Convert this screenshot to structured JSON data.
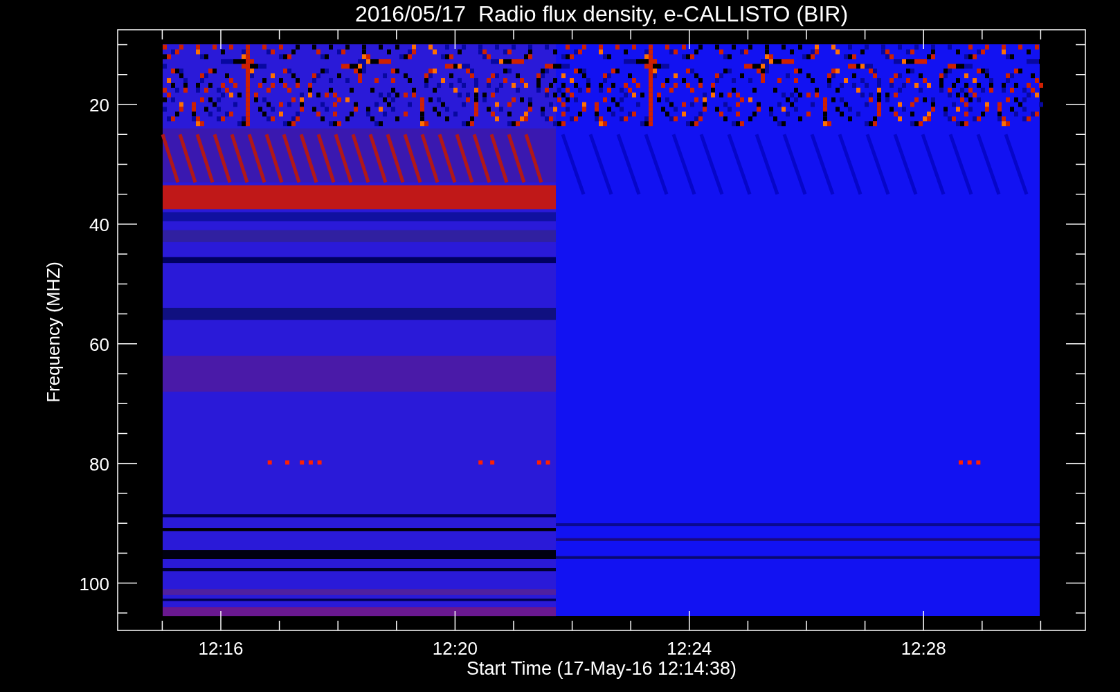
{
  "title": "2016/05/17  Radio flux density, e-CALLISTO (BIR)",
  "xlabel": "Start Time (17-May-16 12:14:38)",
  "ylabel": "Frequency (MHZ)",
  "y_ticks": [
    "20",
    "40",
    "60",
    "80",
    "100"
  ],
  "x_ticks": [
    "12:16",
    "12:20",
    "12:24",
    "12:28"
  ]
}
